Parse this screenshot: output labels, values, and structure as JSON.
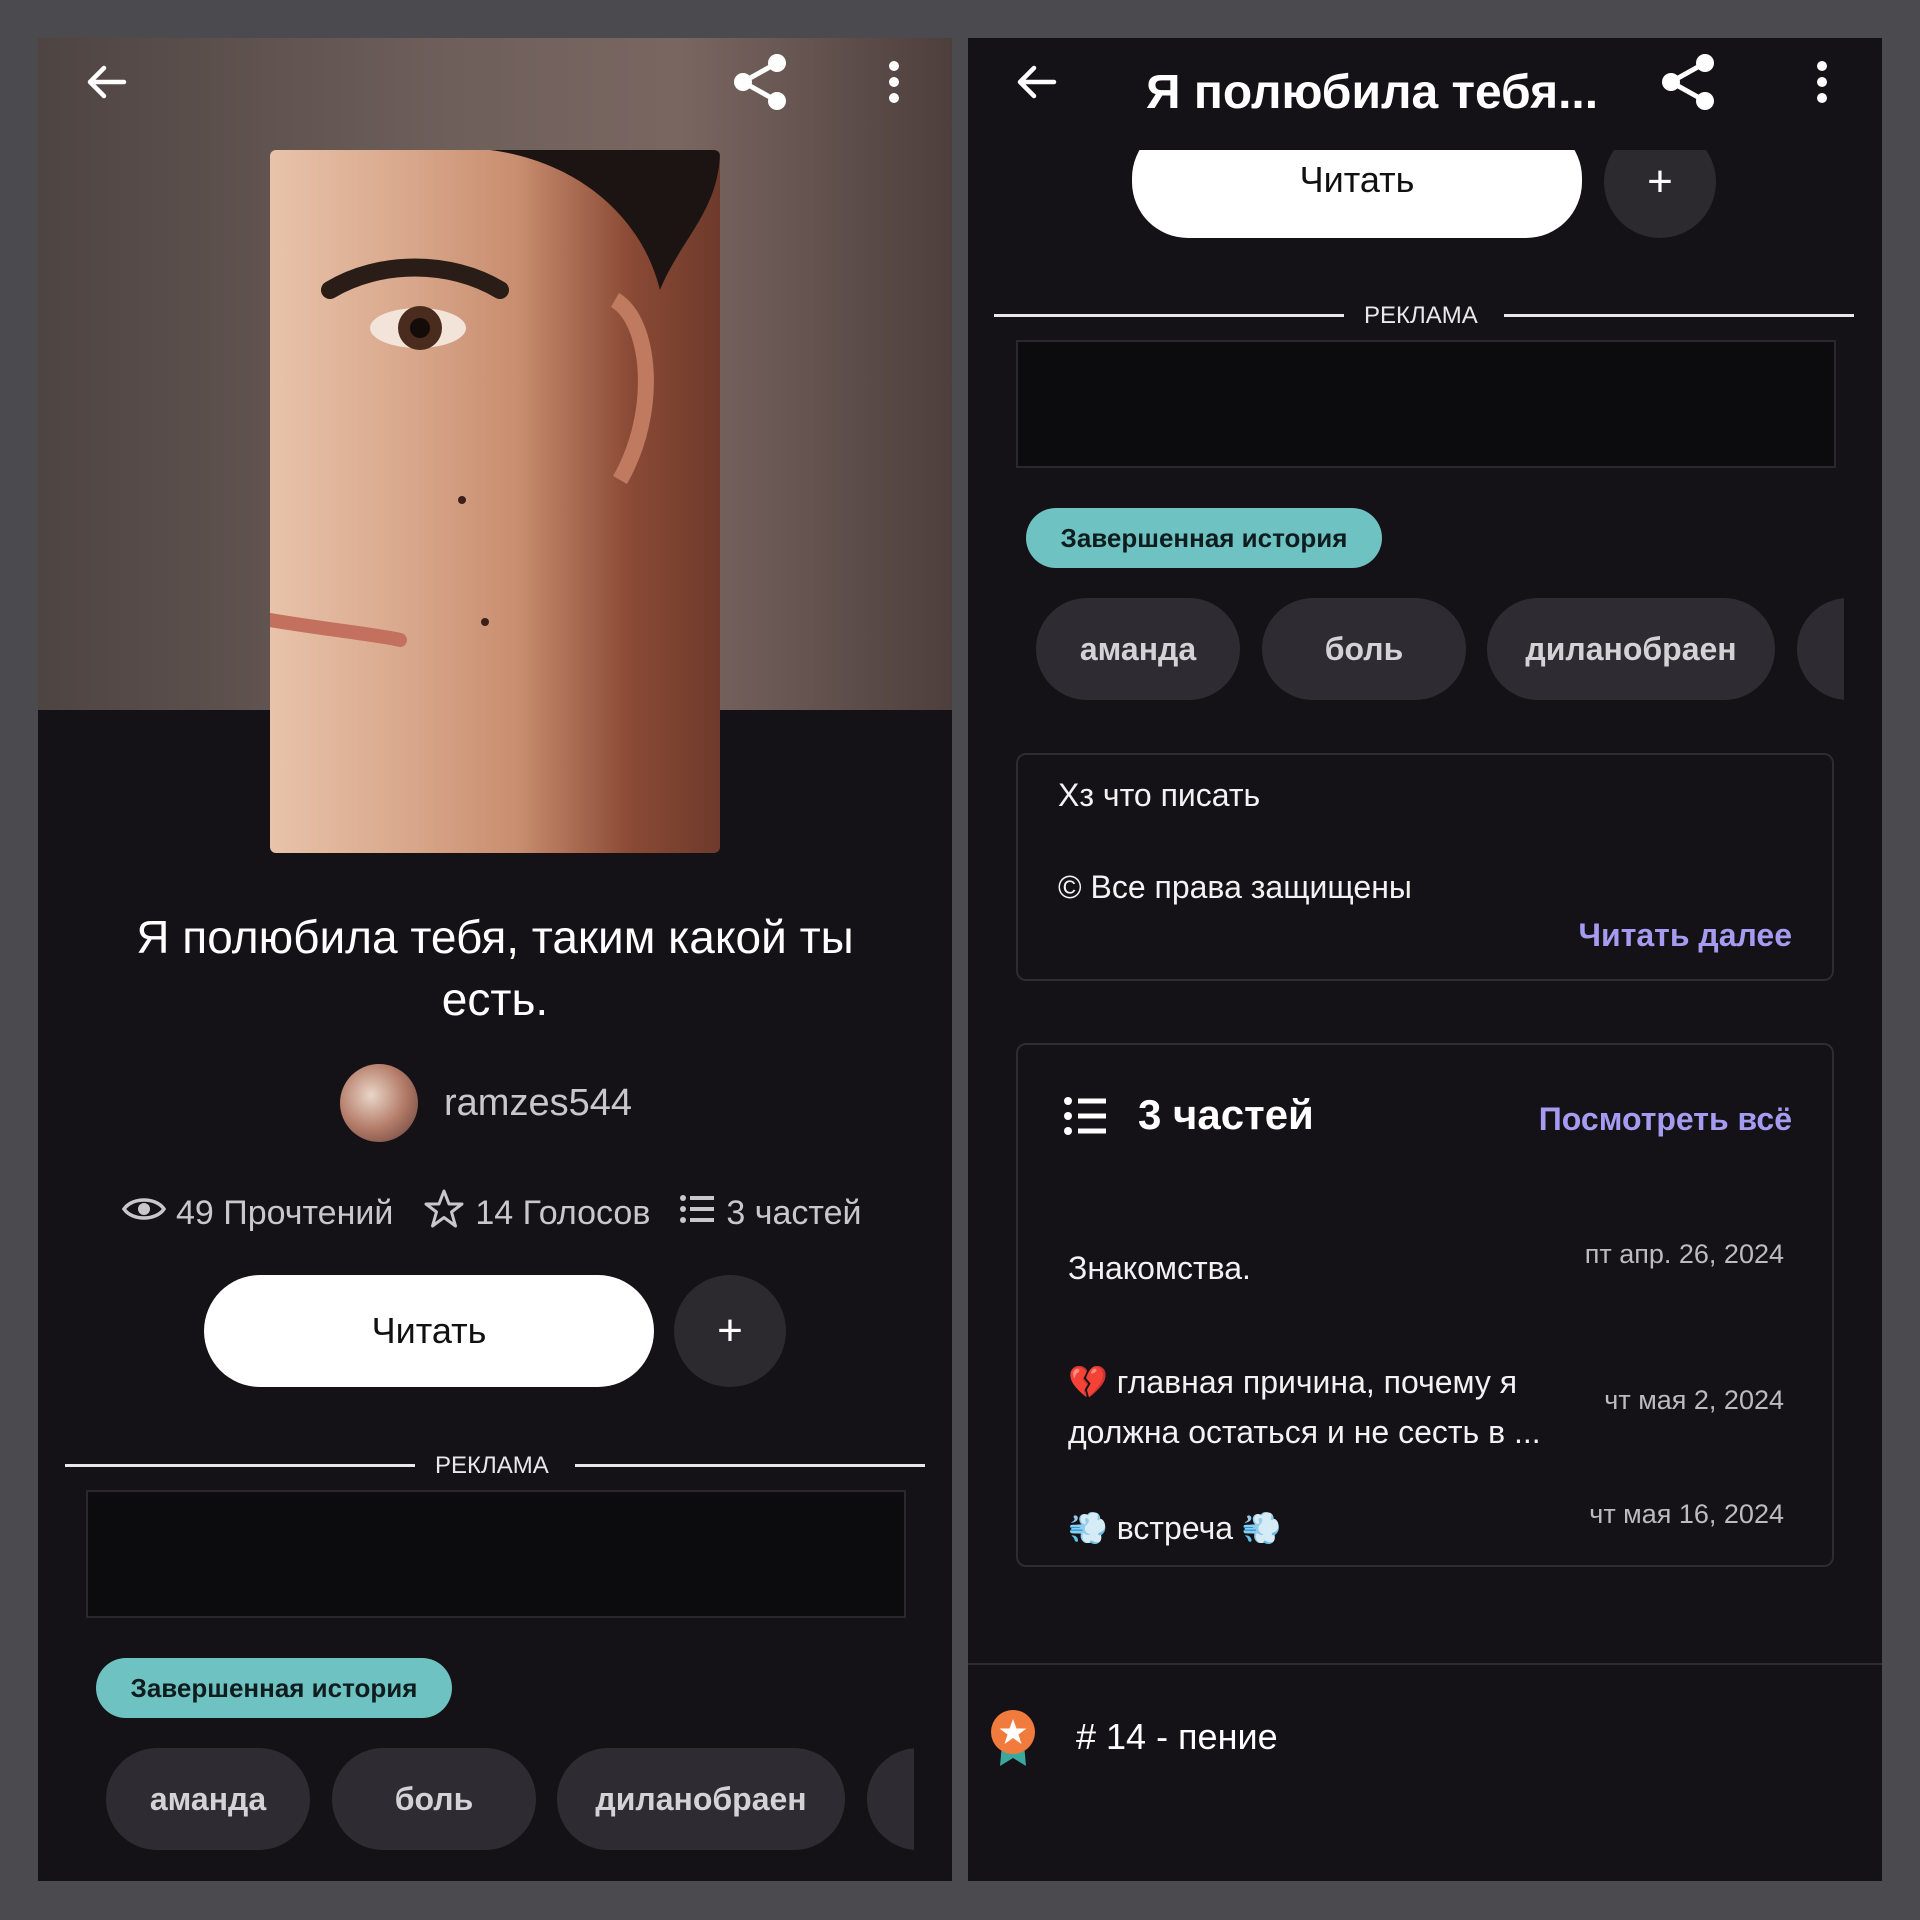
{
  "left": {
    "title": "Я полюбила тебя, таким какой ты есть.",
    "author": "ramzes544",
    "stats": {
      "reads": "49 Прочтений",
      "votes": "14 Голосов",
      "parts": "3 частей"
    },
    "read_button": "Читать",
    "plus_button": "+",
    "ad_label": "РЕКЛАМА",
    "status_badge": "Завершенная история",
    "tags": [
      "аманда",
      "боль",
      "диланобраен"
    ]
  },
  "right": {
    "header_title": "Я полюбила тебя...",
    "read_button": "Читать",
    "plus_button": "+",
    "ad_label": "РЕКЛАМА",
    "status_badge": "Завершенная история",
    "tags": [
      "аманда",
      "боль",
      "диланобраен"
    ],
    "description": {
      "line1": "Хз что писать",
      "line2": "© Все права защищены",
      "read_more": "Читать далее"
    },
    "parts_card": {
      "title": "3 частей",
      "see_all": "Посмотреть всё",
      "parts": [
        {
          "title": "Знакомства.",
          "date": "пт апр. 26, 2024"
        },
        {
          "emoji": "💔",
          "title_line1": "главная причина, почему я",
          "title_line2": "должна остаться и не сесть в ...",
          "date": "чт мая 2, 2024"
        },
        {
          "emoji": "💨",
          "title": "встреча",
          "emoji_after": "💨",
          "date": "чт мая 16, 2024"
        }
      ]
    },
    "ranking": "# 14 - пение"
  },
  "colors": {
    "background": "#141216",
    "badge": "#6fc2c2",
    "link": "#a59cf2",
    "tag": "#2e2c32"
  }
}
